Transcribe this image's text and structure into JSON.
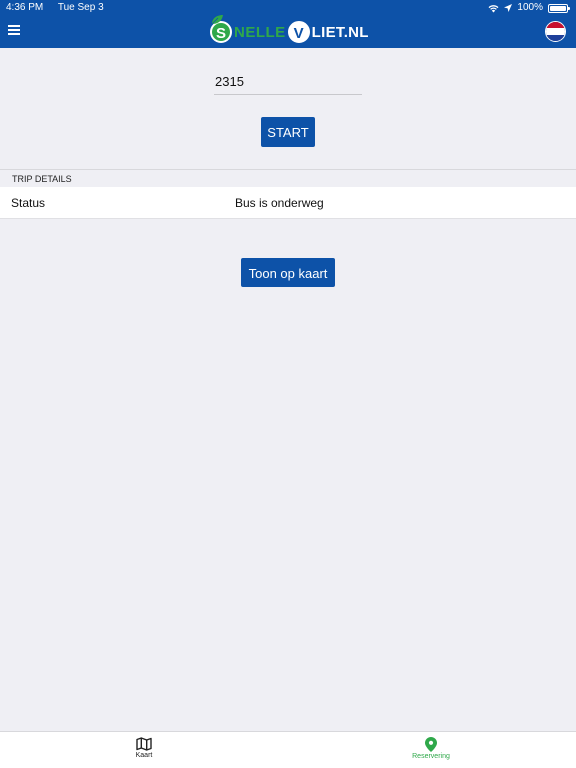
{
  "status_bar": {
    "time": "4:36 PM",
    "date": "Tue Sep 3",
    "battery": "100%",
    "battery_level": 1.0
  },
  "header": {
    "logo_s": "S",
    "logo_nelle": "NELLE",
    "logo_v": "V",
    "logo_liet": "LIET.NL"
  },
  "form": {
    "code_value": "2315",
    "start_label": "START"
  },
  "trip_details": {
    "section_title": "TRIP DETAILS",
    "rows": [
      {
        "label": "Status",
        "value": "Bus is onderweg"
      }
    ]
  },
  "actions": {
    "show_on_map_label": "Toon op kaart"
  },
  "tabbar": {
    "tabs": [
      {
        "label": "Kaart",
        "icon": "map-icon",
        "active": false
      },
      {
        "label": "Reservering",
        "icon": "location-pin-icon",
        "active": true
      }
    ]
  },
  "colors": {
    "brand_blue": "#0d52a8",
    "brand_green": "#2fa84a",
    "background": "#efeff4"
  }
}
